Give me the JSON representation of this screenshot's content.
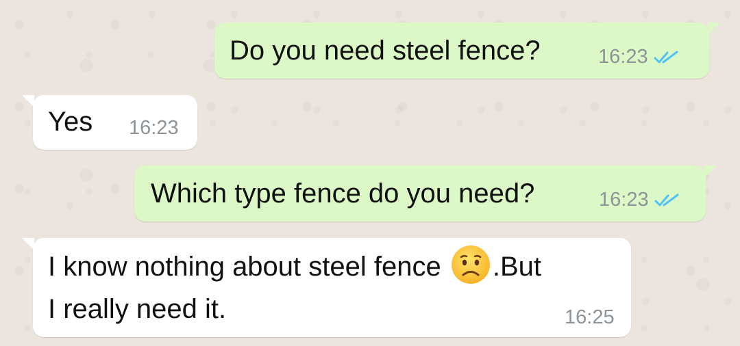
{
  "chat": {
    "messages": [
      {
        "direction": "outgoing",
        "text": "Do you need steel fence?",
        "time": "16:23",
        "status_icon": "double-check-read-icon"
      },
      {
        "direction": "incoming",
        "text": "Yes",
        "time": "16:23"
      },
      {
        "direction": "outgoing",
        "text": "Which type fence do you need?",
        "time": "16:23",
        "status_icon": "double-check-read-icon"
      },
      {
        "direction": "incoming",
        "text_before_emoji": "I know nothing about steel fence ",
        "emoji": "frowning-face-emoji",
        "text_after_emoji": ".But",
        "text_line2": "I really need it.",
        "time": "16:25"
      }
    ]
  },
  "colors": {
    "background": "#ECE5DD",
    "outgoing_bubble": "#DCF8C6",
    "incoming_bubble": "#FFFFFF",
    "read_ticks": "#4FC3F7",
    "timestamp": "#8C9499"
  }
}
